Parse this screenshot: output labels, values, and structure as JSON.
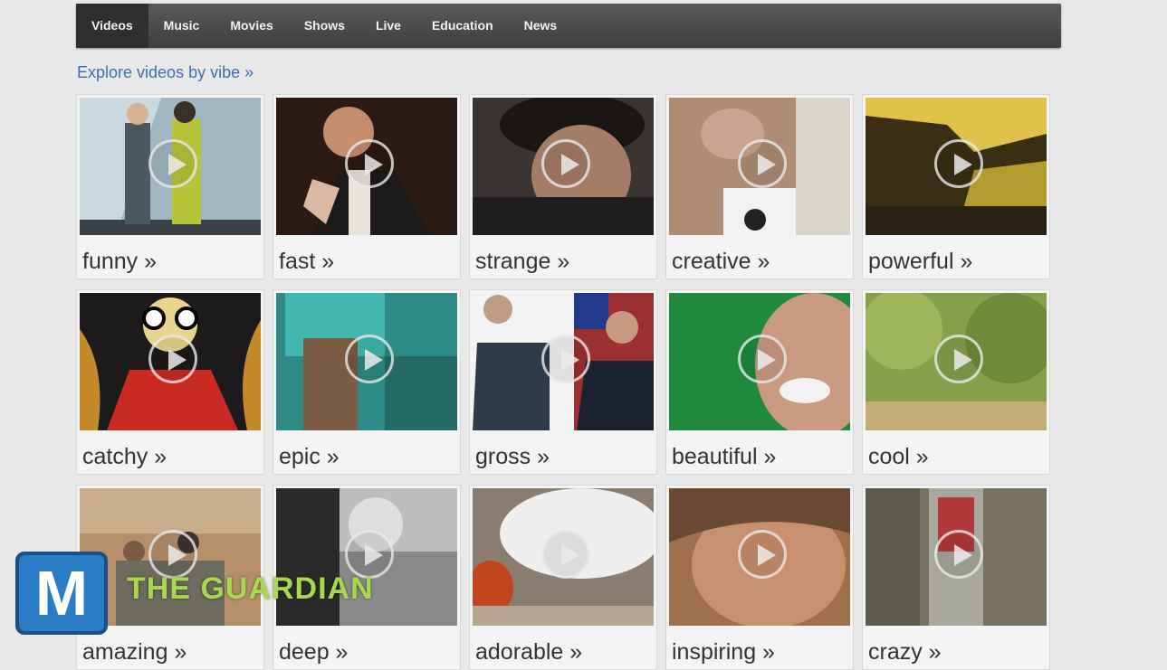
{
  "nav": {
    "tabs": [
      {
        "label": "Videos"
      },
      {
        "label": "Music"
      },
      {
        "label": "Movies"
      },
      {
        "label": "Shows"
      },
      {
        "label": "Live"
      },
      {
        "label": "Education"
      },
      {
        "label": "News"
      }
    ]
  },
  "explore_link": "Explore videos by vibe »",
  "vibes": [
    {
      "label": "funny »"
    },
    {
      "label": "fast »"
    },
    {
      "label": "strange »"
    },
    {
      "label": "creative »"
    },
    {
      "label": "powerful »"
    },
    {
      "label": "catchy »"
    },
    {
      "label": "epic »"
    },
    {
      "label": "gross »"
    },
    {
      "label": "beautiful »"
    },
    {
      "label": "cool »"
    },
    {
      "label": "amazing »"
    },
    {
      "label": "deep »"
    },
    {
      "label": "adorable »"
    },
    {
      "label": "inspiring »"
    },
    {
      "label": "crazy »"
    }
  ],
  "overlay": {
    "logo_letter": "M",
    "watermark": "THE GUARDIAN"
  }
}
